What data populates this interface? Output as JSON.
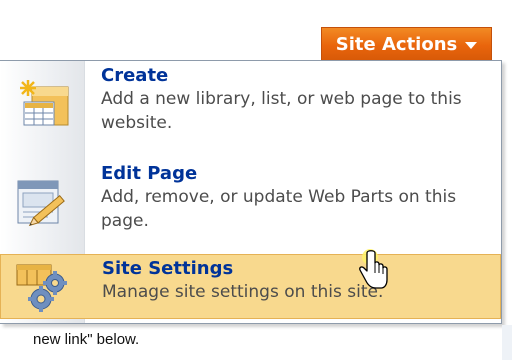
{
  "site_actions": {
    "label": "Site Actions"
  },
  "menu": {
    "items": [
      {
        "title": "Create",
        "description": "Add a new library, list, or web page to this website.",
        "icon": "create-icon"
      },
      {
        "title": "Edit Page",
        "description": "Add, remove, or update Web Parts on this page.",
        "icon": "edit-page-icon"
      },
      {
        "title": "Site Settings",
        "description": "Manage site settings on this site.",
        "icon": "site-settings-icon",
        "selected": true
      }
    ]
  },
  "page_text": {
    "below_text": "new link\" below."
  },
  "colors": {
    "accent": "#e9650c",
    "link": "#003399",
    "highlight": "#f8d98e"
  }
}
